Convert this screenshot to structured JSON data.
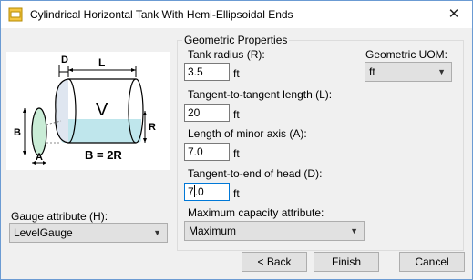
{
  "window": {
    "title": "Cylindrical Horizontal Tank With Hemi-Ellipsoidal Ends",
    "close_glyph": "✕"
  },
  "diagram": {
    "labels": {
      "D": "D",
      "L": "L",
      "V": "V",
      "B": "B",
      "R": "R",
      "A": "A",
      "formula": "B = 2R"
    }
  },
  "geometric": {
    "group_label": "Geometric Properties",
    "tank_radius": {
      "label": "Tank radius (R):",
      "value": "3.5",
      "unit": "ft"
    },
    "tangent_length": {
      "label": "Tangent-to-tangent length (L):",
      "value": "20",
      "unit": "ft"
    },
    "minor_axis": {
      "label": "Length of minor axis (A):",
      "value": "7.0",
      "unit": "ft"
    },
    "end_of_head": {
      "label": "Tangent-to-end of head (D):",
      "value_before_caret": "7",
      "value_after_caret": ".0",
      "unit": "ft"
    },
    "uom": {
      "label": "Geometric UOM:",
      "value": "ft"
    },
    "max_capacity": {
      "label": "Maximum capacity attribute:",
      "value": "Maximum"
    }
  },
  "gauge": {
    "label": "Gauge attribute (H):",
    "value": "LevelGauge"
  },
  "buttons": {
    "back": "< Back",
    "finish": "Finish",
    "cancel": "Cancel"
  },
  "colors": {
    "accent": "#0078d7",
    "liquid": "#bfe6ec",
    "tank_outline": "#000000"
  }
}
